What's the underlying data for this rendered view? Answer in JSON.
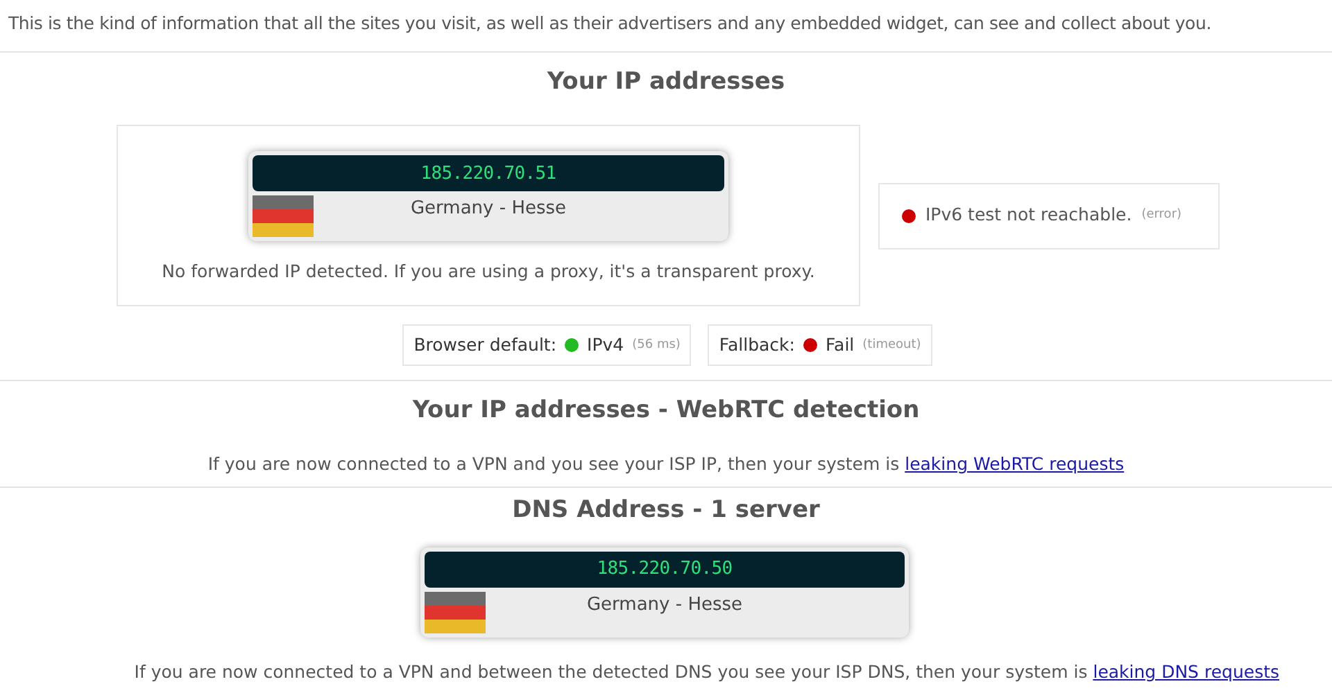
{
  "intro": "This is the kind of information that all the sites you visit, as well as their advertisers and any embedded widget, can see and collect about you.",
  "ip_section": {
    "title": "Your IP addresses",
    "ip_card": {
      "ip": "185.220.70.51",
      "location": "Germany - Hesse"
    },
    "note": "No forwarded IP detected. If you are using a proxy, it's a transparent proxy.",
    "ipv6": {
      "color": "#cc0000",
      "text": "IPv6 test not reachable.",
      "detail": "(error)"
    },
    "checks": [
      {
        "label": "Browser default:",
        "color": "#22bb22",
        "value": "IPv4",
        "detail": "(56 ms)"
      },
      {
        "label": "Fallback:",
        "color": "#cc0000",
        "value": "Fail",
        "detail": "(timeout)"
      }
    ]
  },
  "webrtc_section": {
    "title": "Your IP addresses - WebRTC detection",
    "text": "If you are now connected to a VPN and you see your ISP IP, then your system is",
    "link": "leaking WebRTC requests"
  },
  "dns_section": {
    "title": "DNS Address - 1 server",
    "dns_card": {
      "ip": "185.220.70.50",
      "location": "Germany - Hesse"
    },
    "text": "If you are now connected to a VPN and between the detected DNS you see your ISP DNS, then your system is",
    "link": "leaking DNS requests"
  }
}
